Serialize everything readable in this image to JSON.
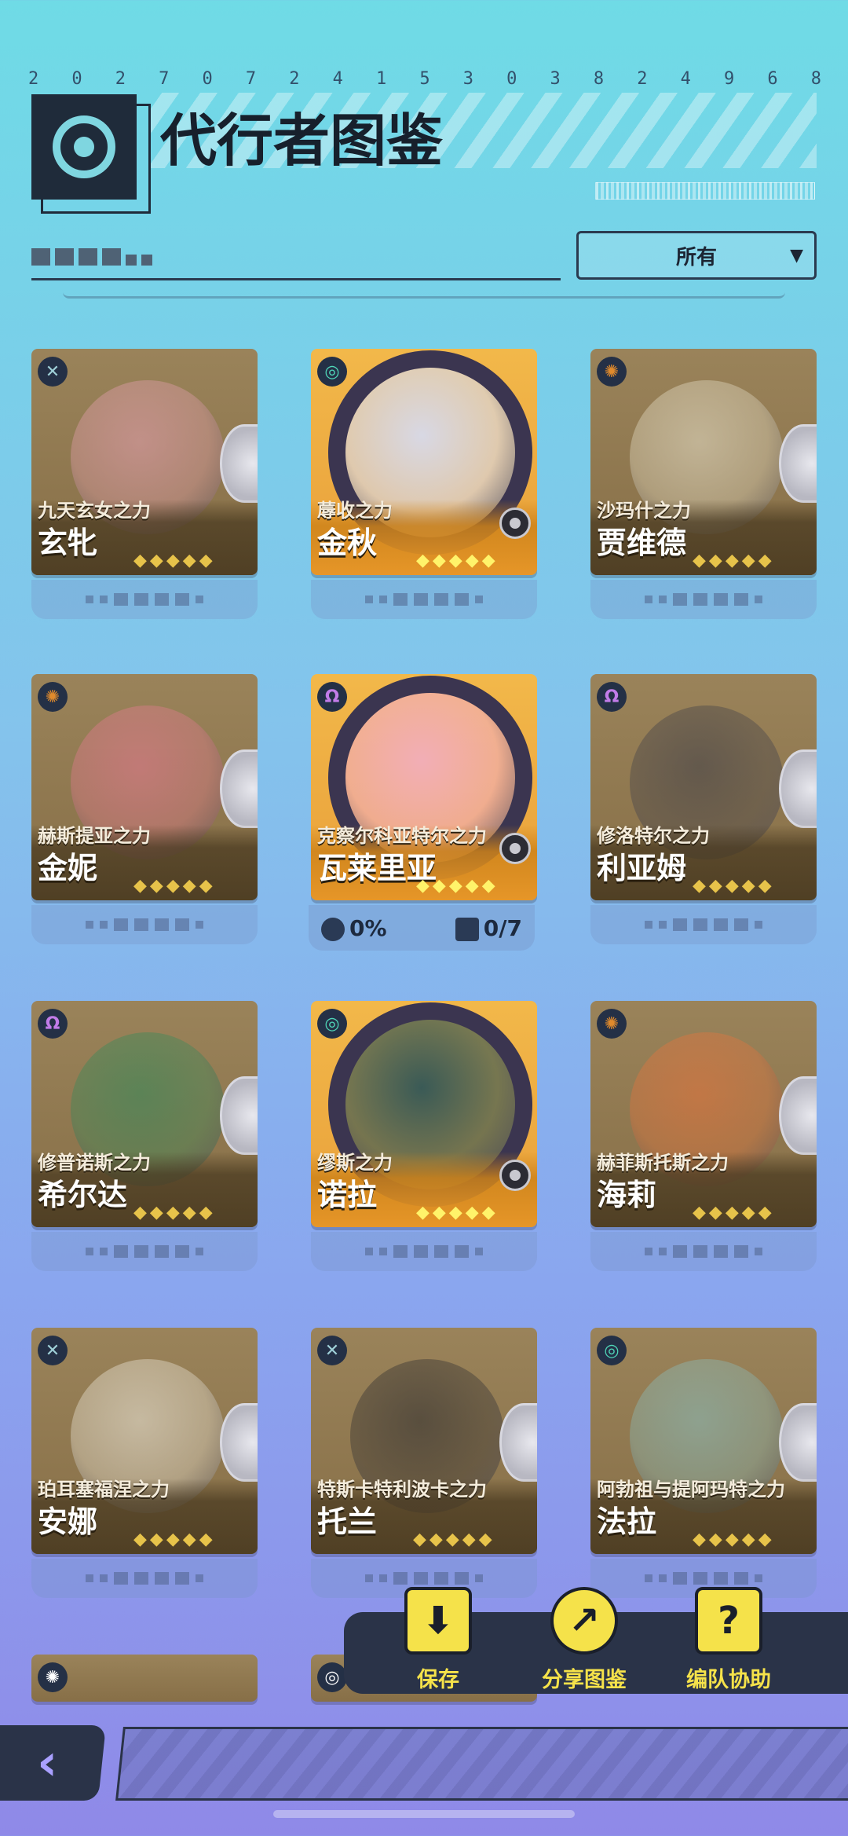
{
  "header": {
    "digits": [
      "2",
      "0",
      "2",
      "7",
      "0",
      "7",
      "2",
      "4",
      "1",
      "5",
      "3",
      "0",
      "3",
      "8",
      "2",
      "4",
      "9",
      "6",
      "8"
    ],
    "title": "代行者图鉴"
  },
  "filter": {
    "selected": "所有"
  },
  "cards": [
    {
      "power": "九天玄女之力",
      "name": "玄牝",
      "element": "x-element",
      "owned": false
    },
    {
      "power": "蓐收之力",
      "name": "金秋",
      "element": "wind-element",
      "owned": true
    },
    {
      "power": "沙玛什之力",
      "name": "贾维德",
      "element": "sun-element",
      "owned": false
    },
    {
      "power": "赫斯提亚之力",
      "name": "金妮",
      "element": "sun-element",
      "owned": false
    },
    {
      "power": "克察尔科亚特尔之力",
      "name": "瓦莱里亚",
      "element": "omega-element",
      "owned": true
    },
    {
      "power": "修洛特尔之力",
      "name": "利亚姆",
      "element": "omega-element",
      "owned": false
    },
    {
      "power": "修普诺斯之力",
      "name": "希尔达",
      "element": "omega-element",
      "owned": false
    },
    {
      "power": "缪斯之力",
      "name": "诺拉",
      "element": "wind-element",
      "owned": true
    },
    {
      "power": "赫菲斯托斯之力",
      "name": "海莉",
      "element": "sun-element",
      "owned": false
    },
    {
      "power": "珀耳塞福涅之力",
      "name": "安娜",
      "element": "x-element",
      "owned": false
    },
    {
      "power": "特斯卡特利波卡之力",
      "name": "托兰",
      "element": "x-element",
      "owned": false
    },
    {
      "power": "阿勃祖与提阿玛特之力",
      "name": "法拉",
      "element": "wind-element",
      "owned": false
    }
  ],
  "selected_stats": {
    "progress": "0%",
    "collected": "0/7"
  },
  "actions": {
    "save": "保存",
    "share": "分享图鉴",
    "team": "编队协助"
  },
  "star_glyph": "◆",
  "colors": {
    "accent_yellow": "#f5e24a",
    "gold_card": "#f2b84a",
    "bronze_card": "#9a835a",
    "dark_panel": "#2a3348"
  }
}
